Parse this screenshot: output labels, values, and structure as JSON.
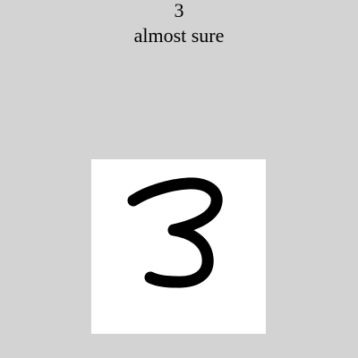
{
  "prediction": {
    "digit": "3",
    "confidence_label": "almost sure"
  },
  "canvas": {
    "drawn_glyph": "handwritten-digit-3",
    "background_color": "#ffffff",
    "stroke_color": "#000000"
  },
  "page": {
    "background_color": "#d3d3d3"
  }
}
